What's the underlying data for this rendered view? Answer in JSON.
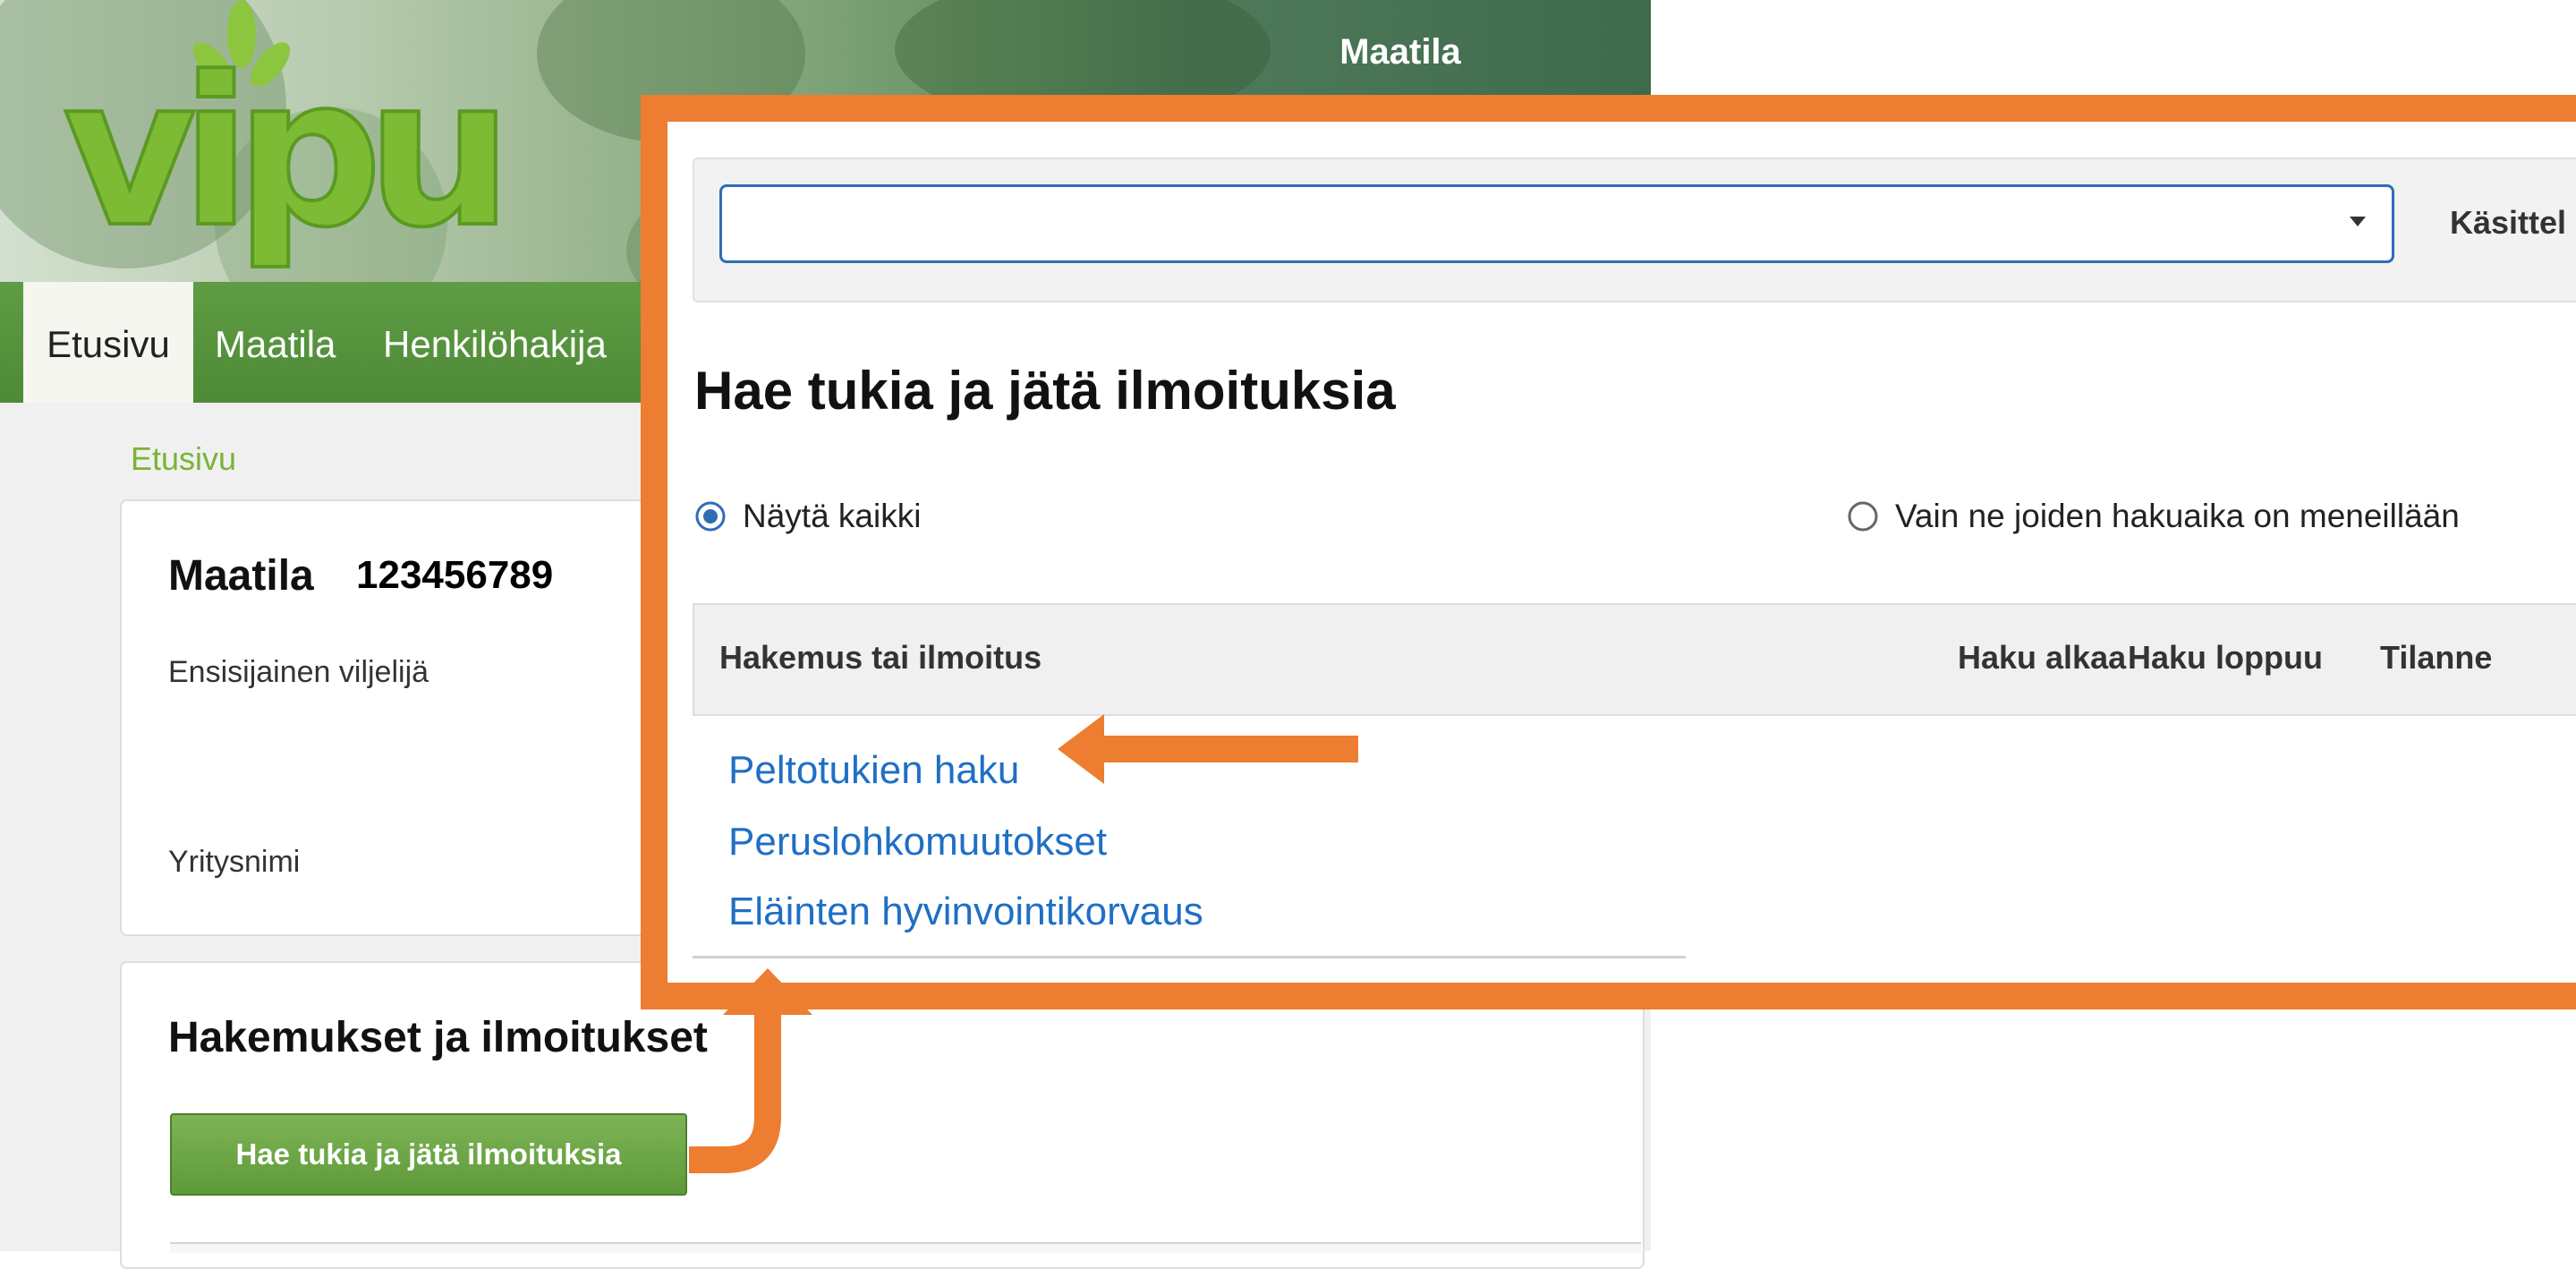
{
  "header": {
    "logo_text": "vipu",
    "title": "Maatila"
  },
  "nav": {
    "items": [
      {
        "label": "Etusivu",
        "active": true
      },
      {
        "label": "Maatila",
        "active": false
      },
      {
        "label": "Henkilöhakija",
        "active": false
      }
    ]
  },
  "breadcrumb": "Etusivu",
  "farm_card": {
    "title": "Maatila",
    "farm_id": "123456789",
    "primary_farmer_label": "Ensisijainen viljelijä",
    "company_name_label": "Yritysnimi"
  },
  "applications_card": {
    "title": "Hakemukset ja ilmoitukset",
    "button_label": "Hae tukia ja jätä ilmoituksia"
  },
  "zoom_panel": {
    "select_value": "",
    "processing_label": "Käsittel",
    "title": "Hae tukia ja jätä ilmoituksia",
    "filters": [
      {
        "label": "Näytä kaikki",
        "selected": true
      },
      {
        "label": "Vain ne joiden hakuaika on meneillään",
        "selected": false
      }
    ],
    "table_headers": [
      "Hakemus tai ilmoitus",
      "Haku alkaa",
      "Haku loppuu",
      "Tilanne"
    ],
    "applications": [
      "Peltotukien haku",
      "Peruslohkomuutokset",
      "Eläinten hyvinvointikorvaus"
    ]
  },
  "colors": {
    "annotation": "#ed7d31",
    "brand_green": "#5e9a3a",
    "link_blue": "#1f6fc5",
    "radio_selected": "#2f6db5"
  },
  "icons": [
    "logo-leaf-icon",
    "chevron-down-icon",
    "radio-selected-icon",
    "radio-unselected-icon",
    "arrow-left-annotation",
    "arrow-up-annotation"
  ]
}
